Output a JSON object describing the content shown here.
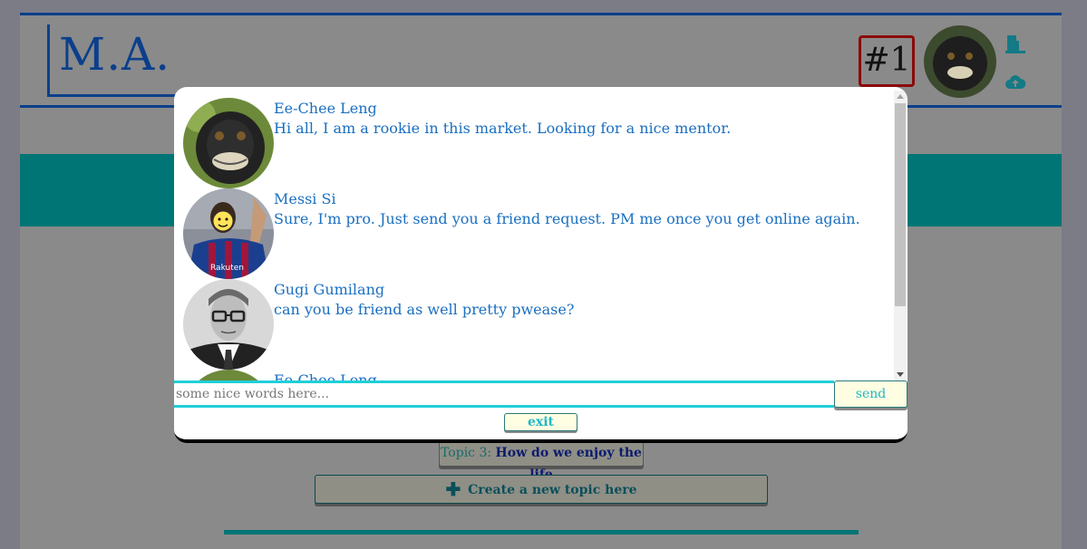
{
  "header": {
    "logo": "M.A.",
    "rank_badge": "#1",
    "icons": [
      "door-exit-icon",
      "cloud-upload-icon"
    ]
  },
  "background": {
    "topic": {
      "label": "Topic 3:",
      "title": "How do we enjoy the life"
    },
    "create_topic": {
      "icon": "plus-icon",
      "label": "Create a new topic here"
    }
  },
  "chat": {
    "messages": [
      {
        "name": "Ee-Chee Leng",
        "text": "Hi all, I am a rookie in this market. Looking for a nice mentor.",
        "avatar": "monkey-avatar"
      },
      {
        "name": "Messi Si",
        "text": "Sure, I'm pro. Just send you a friend request. PM me once you get online again.",
        "avatar": "soccer-player-avatar"
      },
      {
        "name": "Gugi Gumilang",
        "text": "can you be friend as well pretty pwease?",
        "avatar": "man-glasses-avatar"
      },
      {
        "name": "Ee-Chee Leng",
        "text": "",
        "avatar": "monkey-avatar"
      }
    ],
    "input": {
      "value": "",
      "placeholder": "some nice words here..."
    },
    "send_label": "send",
    "exit_label": "exit"
  },
  "colors": {
    "brand_blue": "#0b3f8c",
    "teal": "#007575",
    "accent_cyan": "#1fd0d8",
    "message_text": "#1a6fc0",
    "badge_border": "#8b0a0a"
  }
}
